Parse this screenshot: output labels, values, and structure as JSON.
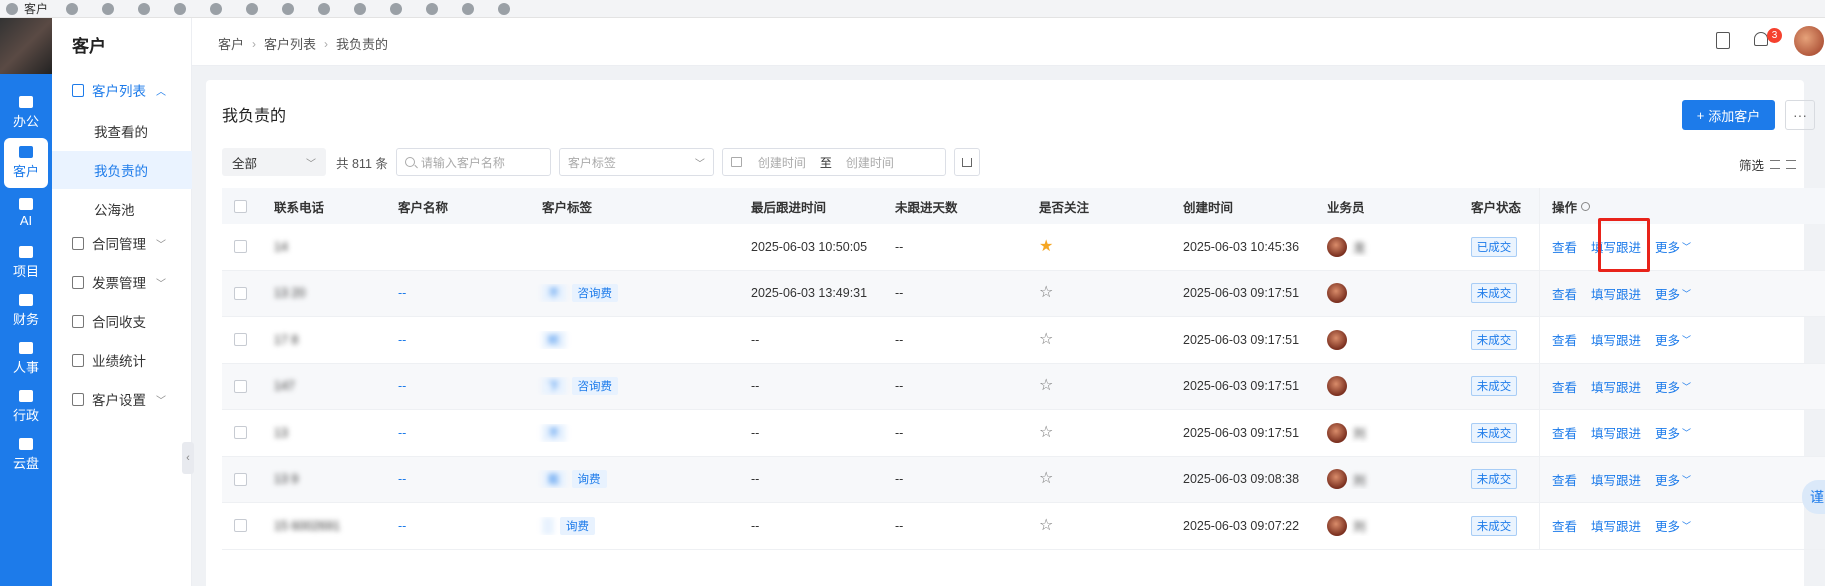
{
  "browser": {
    "bookmarks": [
      "客户",
      "",
      "",
      "",
      "",
      "",
      "",
      "",
      "",
      "",
      "",
      "",
      "",
      ""
    ]
  },
  "rail": {
    "items": [
      {
        "label": "办公",
        "icon": "apps-icon"
      },
      {
        "label": "客户",
        "icon": "customer-icon",
        "active": true
      },
      {
        "label": "AI",
        "icon": "ai-icon"
      },
      {
        "label": "项目",
        "icon": "folder-icon"
      },
      {
        "label": "财务",
        "icon": "finance-icon"
      },
      {
        "label": "人事",
        "icon": "person-card-icon"
      },
      {
        "label": "行政",
        "icon": "briefcase-icon"
      },
      {
        "label": "云盘",
        "icon": "cloud-disk-icon"
      }
    ]
  },
  "subnav": {
    "title": "客户",
    "group_label": "客户列表",
    "sub_items": [
      "我查看的",
      "我负责的",
      "公海池"
    ],
    "groups": [
      "合同管理",
      "发票管理",
      "合同收支",
      "业绩统计",
      "客户设置"
    ]
  },
  "breadcrumb": [
    "客户",
    "客户列表",
    "我负责的"
  ],
  "header": {
    "notification_count": "3"
  },
  "page": {
    "title": "我负责的",
    "add_button": "添加客户",
    "more_button": "···"
  },
  "filters": {
    "scope": "全部",
    "total": "共 811 条",
    "search_placeholder": "请输入客户名称",
    "tag_placeholder": "客户标签",
    "date_start": "创建时间",
    "date_sep": "至",
    "date_end": "创建时间",
    "screen_label": "筛选"
  },
  "table": {
    "columns": [
      "联系电话",
      "客户名称",
      "客户标签",
      "最后跟进时间",
      "未跟进天数",
      "是否关注",
      "创建时间",
      "业务员",
      "客户状态",
      "操作"
    ],
    "rows": [
      {
        "phone": "14",
        "name": "",
        "tags": [],
        "last_follow": "2025-06-03 10:50:05",
        "days": "--",
        "focus": true,
        "created": "2025-06-03 10:45:36",
        "sales": "龙",
        "status": "已成交",
        "ops": [
          "查看",
          "填写跟进",
          "更多"
        ]
      },
      {
        "phone": "13      20",
        "name": "--",
        "tags": [
          "不",
          "咨询费"
        ],
        "last_follow": "2025-06-03 13:49:31",
        "days": "--",
        "focus": false,
        "created": "2025-06-03 09:17:51",
        "sales": "",
        "status": "未成交",
        "ops": [
          "查看",
          "填写跟进",
          "更多"
        ]
      },
      {
        "phone": "17      8",
        "name": "--",
        "tags": [
          "听"
        ],
        "last_follow": "--",
        "days": "--",
        "focus": false,
        "created": "2025-06-03 09:17:51",
        "sales": "",
        "status": "未成交",
        "ops": [
          "查看",
          "填写跟进",
          "更多"
        ]
      },
      {
        "phone": "147",
        "name": "--",
        "tags": [
          "下",
          "咨询费"
        ],
        "last_follow": "--",
        "days": "--",
        "focus": false,
        "created": "2025-06-03 09:17:51",
        "sales": "",
        "status": "未成交",
        "ops": [
          "查看",
          "填写跟进",
          "更多"
        ]
      },
      {
        "phone": "13",
        "name": "--",
        "tags": [
          "不"
        ],
        "last_follow": "--",
        "days": "--",
        "focus": false,
        "created": "2025-06-03 09:17:51",
        "sales": "刘",
        "status": "未成交",
        "ops": [
          "查看",
          "填写跟进",
          "更多"
        ]
      },
      {
        "phone": "13      9",
        "name": "--",
        "tags": [
          "能",
          "询费"
        ],
        "last_follow": "--",
        "days": "--",
        "focus": false,
        "created": "2025-06-03 09:08:38",
        "sales": "刘",
        "status": "未成交",
        "ops": [
          "查看",
          "填写跟进",
          "更多"
        ]
      },
      {
        "phone": "15  6002691",
        "name": "--",
        "tags": [
          "",
          "询费"
        ],
        "last_follow": "--",
        "days": "--",
        "focus": false,
        "created": "2025-06-03 09:07:22",
        "sales": "刘",
        "status": "未成交",
        "ops": [
          "查看",
          "填写跟进",
          "更多"
        ]
      }
    ]
  },
  "floating_chip": "谨",
  "colors": {
    "primary": "#1d7bea",
    "highlight": "#e8231a",
    "star": "#f5a623",
    "badge": "#f5412e"
  }
}
